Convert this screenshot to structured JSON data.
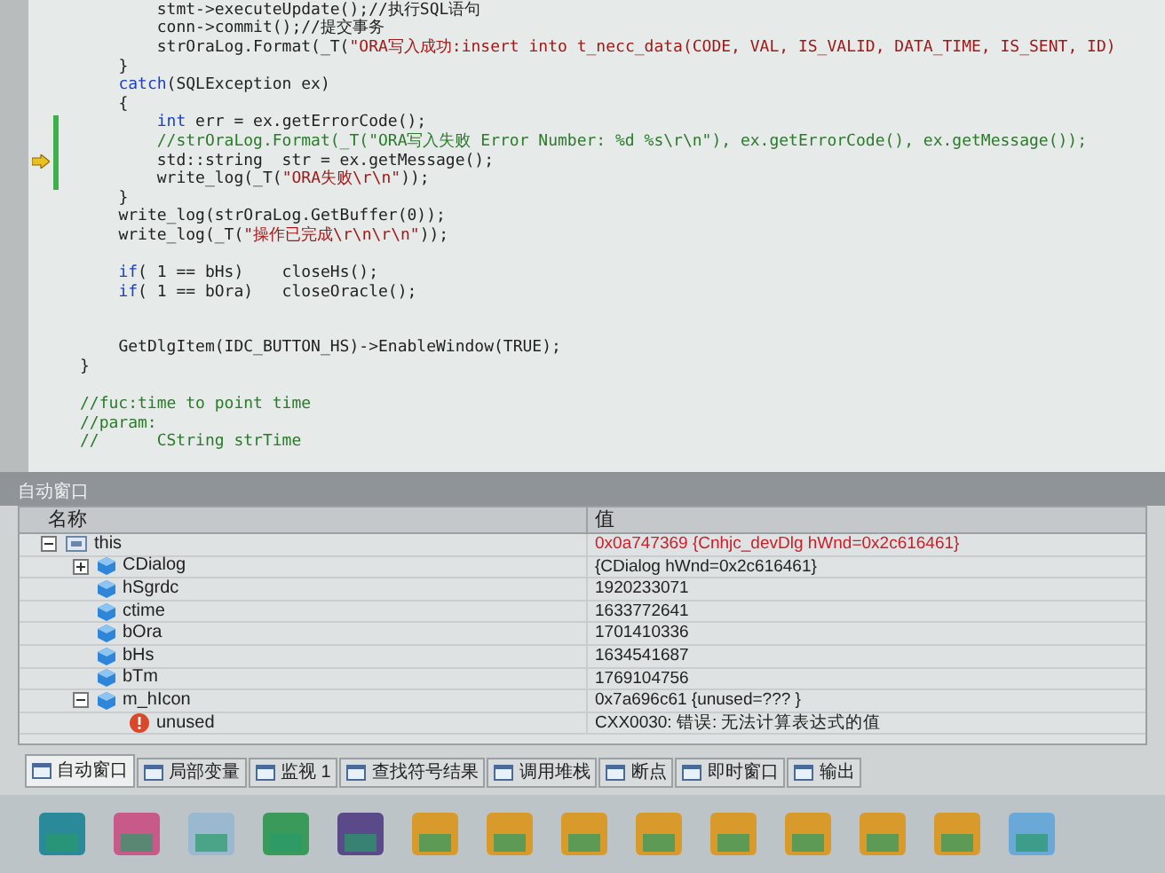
{
  "editor": {
    "lines": [
      {
        "current": false,
        "changed": false,
        "segments": [
          {
            "kind": "plain",
            "text": "        stmt->executeUpdate();//执行SQL语句"
          }
        ]
      },
      {
        "current": false,
        "changed": false,
        "segments": [
          {
            "kind": "plain",
            "text": "        conn->commit();//提交事务"
          }
        ]
      },
      {
        "current": false,
        "changed": false,
        "segments": [
          {
            "kind": "plain",
            "text": "        strOraLog.Format(_T("
          },
          {
            "kind": "string",
            "text": "\"ORA写入成功:insert into t_necc_data(CODE, VAL, IS_VALID, DATA_TIME, IS_SENT, ID)"
          }
        ]
      },
      {
        "current": false,
        "changed": false,
        "segments": [
          {
            "kind": "plain",
            "text": "    }"
          }
        ]
      },
      {
        "current": false,
        "changed": false,
        "segments": [
          {
            "kind": "keyword",
            "text": "    catch"
          },
          {
            "kind": "plain",
            "text": "(SQLException ex)"
          }
        ]
      },
      {
        "current": false,
        "changed": false,
        "segments": [
          {
            "kind": "plain",
            "text": "    {"
          }
        ]
      },
      {
        "current": false,
        "changed": true,
        "segments": [
          {
            "kind": "keyword",
            "text": "        int"
          },
          {
            "kind": "plain",
            "text": " err = ex.getErrorCode();"
          }
        ]
      },
      {
        "current": false,
        "changed": true,
        "segments": [
          {
            "kind": "comment",
            "text": "        //strOraLog.Format(_T(\"ORA写入失败 Error Number: %d %s\\r\\n\"), ex.getErrorCode(), ex.getMessage());"
          }
        ]
      },
      {
        "current": true,
        "changed": true,
        "segments": [
          {
            "kind": "plain",
            "text": "        std::string  str = ex.getMessage();"
          }
        ]
      },
      {
        "current": false,
        "changed": true,
        "segments": [
          {
            "kind": "plain",
            "text": "        write_log(_T("
          },
          {
            "kind": "string",
            "text": "\"ORA失败\\r\\n\""
          },
          {
            "kind": "plain",
            "text": "));"
          }
        ]
      },
      {
        "current": false,
        "changed": false,
        "segments": [
          {
            "kind": "plain",
            "text": "    }"
          }
        ]
      },
      {
        "current": false,
        "changed": false,
        "segments": [
          {
            "kind": "plain",
            "text": "    write_log(strOraLog.GetBuffer(0));"
          }
        ]
      },
      {
        "current": false,
        "changed": false,
        "segments": [
          {
            "kind": "plain",
            "text": "    write_log(_T("
          },
          {
            "kind": "string",
            "text": "\"操作已完成\\r\\n\\r\\n\""
          },
          {
            "kind": "plain",
            "text": "));"
          }
        ]
      },
      {
        "current": false,
        "changed": false
      },
      {
        "current": false,
        "changed": false,
        "segments": [
          {
            "kind": "keyword",
            "text": "    if"
          },
          {
            "kind": "plain",
            "text": "( 1 == bHs)    closeHs();"
          }
        ]
      },
      {
        "current": false,
        "changed": false,
        "segments": [
          {
            "kind": "keyword",
            "text": "    if"
          },
          {
            "kind": "plain",
            "text": "( 1 == bOra)   closeOracle();"
          }
        ]
      },
      {
        "current": false,
        "changed": false
      },
      {
        "current": false,
        "changed": false
      },
      {
        "current": false,
        "changed": false,
        "segments": [
          {
            "kind": "plain",
            "text": "    GetDlgItem(IDC_BUTTON_HS)->EnableWindow(TRUE);"
          }
        ]
      },
      {
        "current": false,
        "changed": false,
        "segments": [
          {
            "kind": "plain",
            "text": "}"
          }
        ]
      },
      {
        "current": false,
        "changed": false
      },
      {
        "current": false,
        "changed": false,
        "segments": [
          {
            "kind": "comment",
            "text": "//fuc:time to point time"
          }
        ]
      },
      {
        "current": false,
        "changed": false,
        "segments": [
          {
            "kind": "comment",
            "text": "//param:"
          }
        ]
      },
      {
        "current": false,
        "changed": false,
        "segments": [
          {
            "kind": "comment",
            "text": "//      CString strTime"
          }
        ]
      }
    ]
  },
  "autos": {
    "title": "自动窗口",
    "columns": [
      "名称",
      "值"
    ],
    "items": [
      {
        "name": "this",
        "value": "0x0a747369 {Cnhjc_devDlg hWnd=0x2c616461}",
        "kind": "object",
        "changed": true,
        "expanded": true,
        "children": [
          {
            "name": "CDialog",
            "value": "{CDialog hWnd=0x2c616461}",
            "kind": "field",
            "changed": false,
            "expanded": false
          },
          {
            "name": "hSgrdc",
            "value": "1920233071",
            "kind": "field",
            "changed": false
          },
          {
            "name": "ctime",
            "value": "1633772641",
            "kind": "field",
            "changed": false
          },
          {
            "name": "bOra",
            "value": "1701410336",
            "kind": "field",
            "changed": false
          },
          {
            "name": "bHs",
            "value": "1634541687",
            "kind": "field",
            "changed": false
          },
          {
            "name": "bTm",
            "value": "1769104756",
            "kind": "field",
            "changed": false
          },
          {
            "name": "m_hIcon",
            "value": "0x7a696c61 {unused=??? }",
            "kind": "field",
            "changed": false,
            "expanded": true,
            "children": [
              {
                "name": "unused",
                "value": "CXX0030: 错误: 无法计算表达式的值",
                "kind": "error",
                "changed": false
              }
            ]
          }
        ]
      }
    ]
  },
  "tabs": [
    {
      "label": "自动窗口",
      "selected": true
    },
    {
      "label": "局部变量",
      "selected": false
    },
    {
      "label": "监视 1",
      "selected": false
    },
    {
      "label": "查找符号结果",
      "selected": false
    },
    {
      "label": "调用堆栈",
      "selected": false
    },
    {
      "label": "断点",
      "selected": false
    },
    {
      "label": "即时窗口",
      "selected": false
    },
    {
      "label": "输出",
      "selected": false
    }
  ]
}
